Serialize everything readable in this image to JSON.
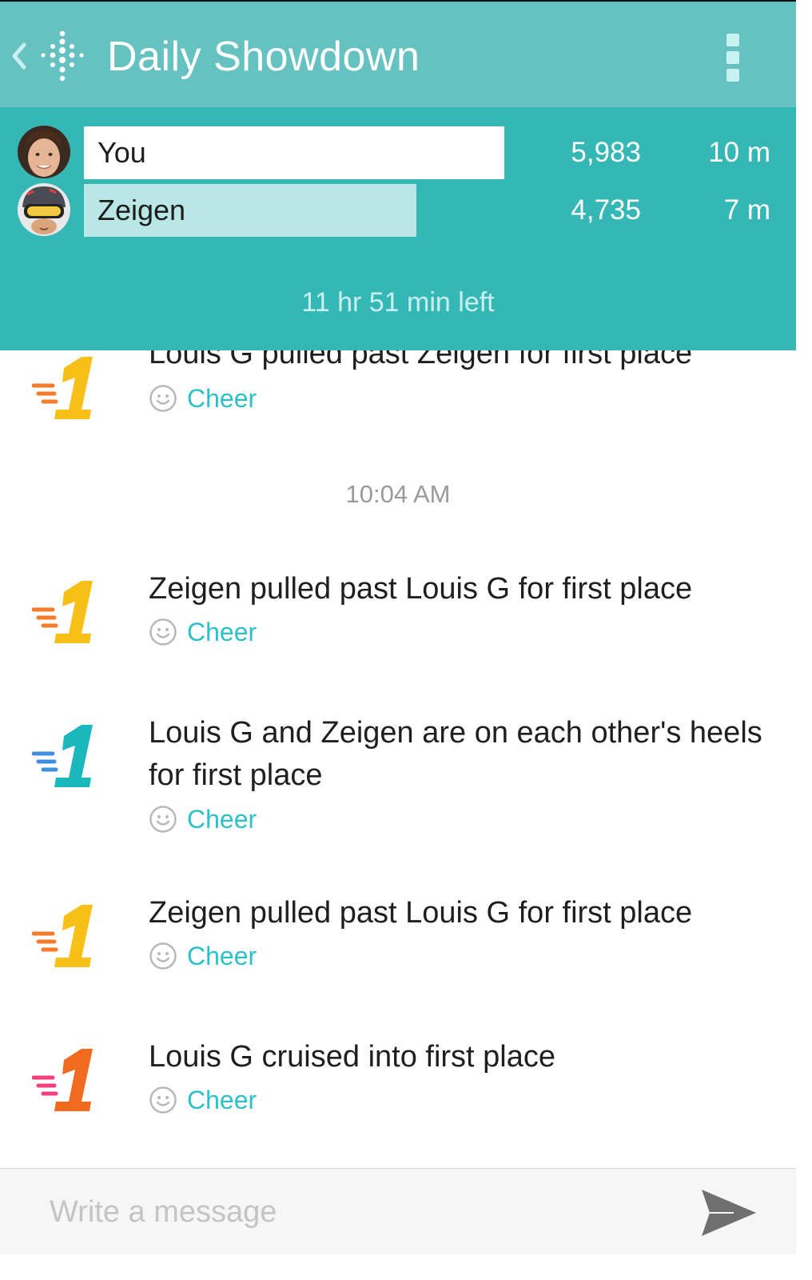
{
  "header": {
    "title": "Daily Showdown",
    "back_icon": "chevron-left-icon",
    "logo_icon": "fitbit-dots-logo",
    "menu_icon": "more-vertical-icon"
  },
  "leaderboard": {
    "players": [
      {
        "name": "You",
        "steps": "5,983",
        "distance": "10 m",
        "progress": 1.0
      },
      {
        "name": "Zeigen",
        "steps": "4,735",
        "distance": "7 m",
        "progress": 0.79
      }
    ],
    "time_left": "11 hr 51 min left"
  },
  "feed": {
    "timestamp": "10:04 AM",
    "cheer_label": "Cheer",
    "items": [
      {
        "text": "Louis G pulled past Zeigen for first place",
        "icon": "rank-1-orange-icon"
      },
      {
        "text": "Zeigen pulled past Louis G for first place",
        "icon": "rank-1-orange-icon"
      },
      {
        "text": "Louis G and Zeigen are on each other's heels for first place",
        "icon": "rank-1-teal-icon"
      },
      {
        "text": "Zeigen pulled past Louis G for first place",
        "icon": "rank-1-orange-icon"
      },
      {
        "text": "Louis G cruised into first place",
        "icon": "rank-1-red-orange-icon"
      }
    ]
  },
  "composer": {
    "placeholder": "Write a message",
    "send_icon": "send-icon"
  },
  "colors": {
    "toolbar": "#66c2c0",
    "leaderboard": "#35b7b5",
    "you_bar": "#ffffff",
    "other_bar": "#b9e7e6",
    "cheer": "#2cc0c8",
    "rank_yellow": "#f7bf17",
    "rank_orange": "#f57a2a",
    "rank_teal": "#1ab8bd",
    "rank_blue": "#3f8fe0",
    "rank_red": "#f26a1f",
    "rank_pink": "#f0417a"
  }
}
